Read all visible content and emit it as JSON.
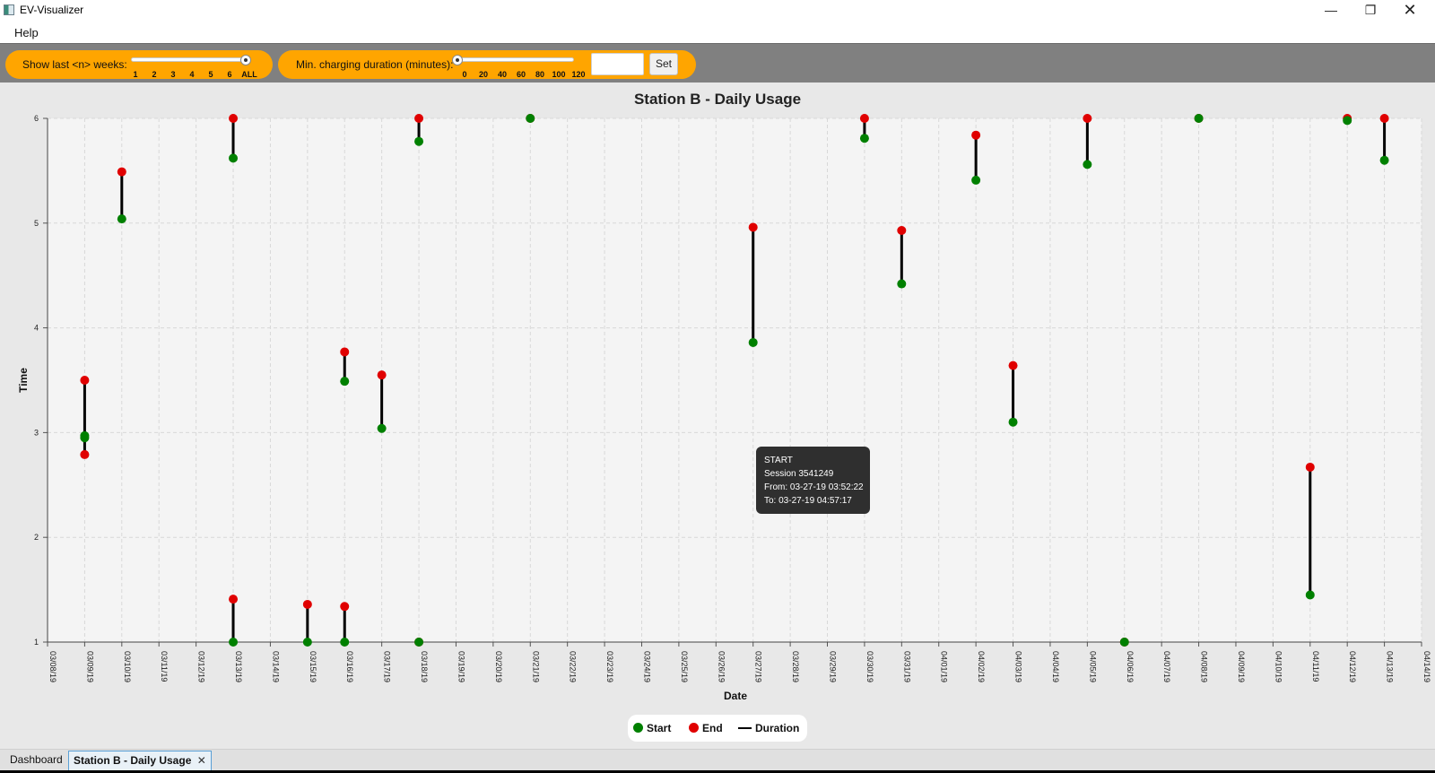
{
  "window": {
    "title": "EV-Visualizer",
    "minimize": "—",
    "maximize": "❐",
    "close": "✕"
  },
  "menu": {
    "help": "Help"
  },
  "toolbar": {
    "weeks": {
      "label": "Show last <n> weeks:",
      "ticks": [
        "1",
        "2",
        "3",
        "4",
        "5",
        "6",
        "ALL"
      ],
      "selected": "ALL"
    },
    "duration": {
      "label": "Min. charging duration (minutes):",
      "ticks": [
        "0",
        "20",
        "40",
        "60",
        "80",
        "100",
        "120"
      ],
      "selected": "0",
      "input_value": "",
      "set_label": "Set"
    }
  },
  "tooltip": {
    "line1": "START",
    "line2": "Session 3541249",
    "line3": "From: 03-27-19 03:52:22",
    "line4": "To: 03-27-19 04:57:17"
  },
  "legend": {
    "start": "Start",
    "end": "End",
    "duration": "Duration"
  },
  "tabs": {
    "dashboard": "Dashboard",
    "active": "Station B - Daily Usage",
    "close": "✕"
  },
  "colors": {
    "start": "#008000",
    "end": "#e00000",
    "duration": "#000000",
    "accent": "#ffa500",
    "plot_bg": "#f4f4f4"
  },
  "chart_data": {
    "type": "scatter",
    "title": "Station B - Daily Usage",
    "xlabel": "Date",
    "ylabel": "Time",
    "categories": [
      "03/08/19",
      "03/09/19",
      "03/10/19",
      "03/11/19",
      "03/12/19",
      "03/13/19",
      "03/14/19",
      "03/15/19",
      "03/16/19",
      "03/17/19",
      "03/18/19",
      "03/19/19",
      "03/20/19",
      "03/21/19",
      "03/22/19",
      "03/23/19",
      "03/24/19",
      "03/25/19",
      "03/26/19",
      "03/27/19",
      "03/28/19",
      "03/29/19",
      "03/30/19",
      "03/31/19",
      "04/01/19",
      "04/02/19",
      "04/03/19",
      "04/04/19",
      "04/05/19",
      "04/06/19",
      "04/07/19",
      "04/08/19",
      "04/09/19",
      "04/10/19",
      "04/11/19",
      "04/12/19",
      "04/13/19",
      "04/14/19"
    ],
    "yticks": [
      "1",
      "2",
      "3",
      "4",
      "5",
      "6"
    ],
    "ylim": [
      1,
      6
    ],
    "grid": true,
    "legend_position": "bottom",
    "sessions": [
      {
        "date": "03/09/19",
        "start": 2.97,
        "end": 3.5
      },
      {
        "date": "03/09/19",
        "start": 2.95,
        "end": 2.79
      },
      {
        "date": "03/10/19",
        "start": 5.04,
        "end": 5.49
      },
      {
        "date": "03/13/19",
        "start": 5.62,
        "end": 6.0
      },
      {
        "date": "03/13/19",
        "start": 1.0,
        "end": 1.41
      },
      {
        "date": "03/15/19",
        "start": 1.0,
        "end": 1.36
      },
      {
        "date": "03/16/19",
        "start": 3.49,
        "end": 3.77
      },
      {
        "date": "03/16/19",
        "start": 1.0,
        "end": 1.34
      },
      {
        "date": "03/17/19",
        "start": 3.04,
        "end": 3.55
      },
      {
        "date": "03/18/19",
        "start": 5.78,
        "end": 6.0
      },
      {
        "date": "03/18/19",
        "start": 1.0,
        "end": 1.0
      },
      {
        "date": "03/21/19",
        "start": 6.0,
        "end": 6.0
      },
      {
        "date": "03/27/19",
        "start": 3.86,
        "end": 4.96
      },
      {
        "date": "03/30/19",
        "start": 5.81,
        "end": 6.0
      },
      {
        "date": "03/31/19",
        "start": 4.42,
        "end": 4.93
      },
      {
        "date": "04/02/19",
        "start": 5.41,
        "end": 5.84
      },
      {
        "date": "04/03/19",
        "start": 3.1,
        "end": 3.64
      },
      {
        "date": "04/05/19",
        "start": 5.56,
        "end": 6.0
      },
      {
        "date": "04/06/19",
        "start": 1.0,
        "end": 1.0
      },
      {
        "date": "04/08/19",
        "start": 6.0,
        "end": 6.0
      },
      {
        "date": "04/11/19",
        "start": 1.45,
        "end": 2.67
      },
      {
        "date": "04/12/19",
        "start": 5.98,
        "end": 6.0
      },
      {
        "date": "04/13/19",
        "start": 5.6,
        "end": 6.0
      }
    ]
  }
}
